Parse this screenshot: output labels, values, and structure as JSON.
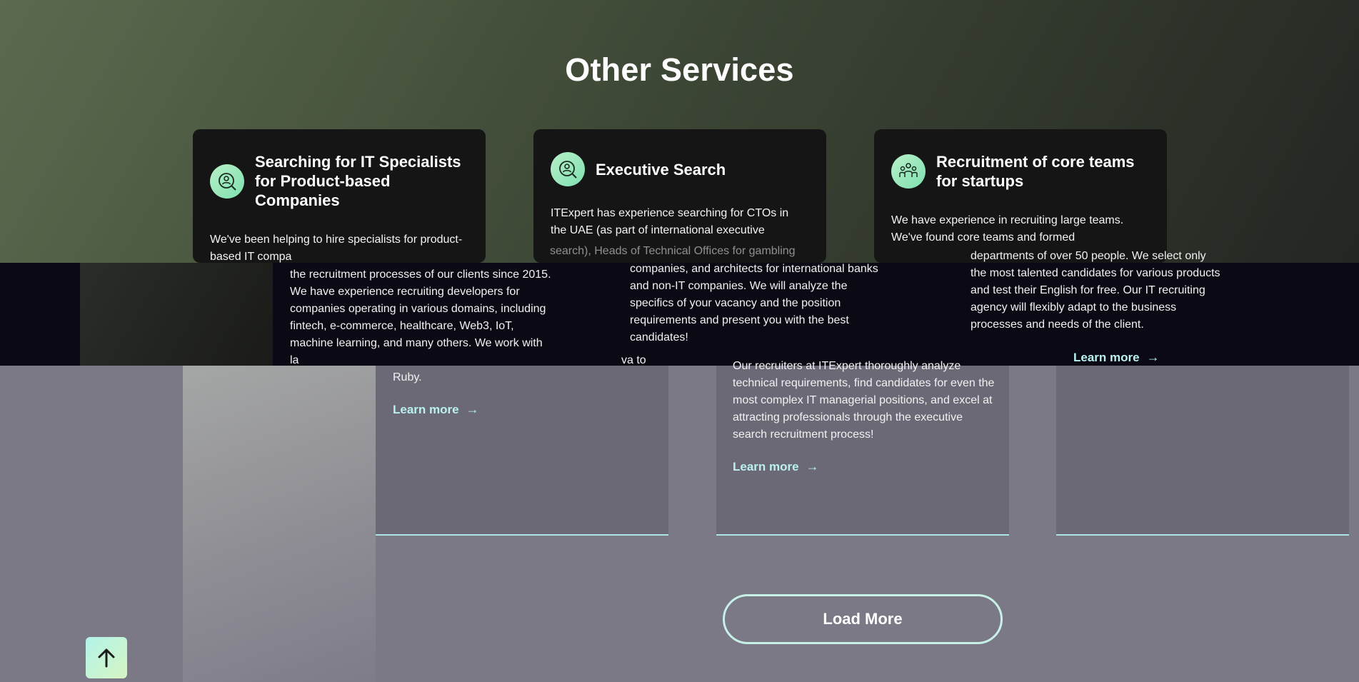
{
  "section": {
    "title": "Other Services"
  },
  "cards": [
    {
      "icon": "person-search-icon",
      "title": "Searching for IT Specialists for Product-based Companies",
      "intro": "We've been helping to hire specialists for product-based IT compa",
      "body": "the recruitment processes of our clients since 2015. We have experience recruiting developers for companies operating in various domains, including fintech, e-commerce, healthcare, Web3, IoT, machine learning, and many others. We work with la",
      "tail_suffix": "va to",
      "tail_end": "Ruby.",
      "learn_more": "Learn more"
    },
    {
      "icon": "person-search-icon",
      "title": "Executive Search",
      "intro": "ITExpert has experience searching for CTOs in the UAE (as part of international executive",
      "intro_tail": "search), Heads of Technical Offices for gambling",
      "body": "companies, and architects for international banks and non-IT companies. We will analyze the specifics of your vacancy and the position requirements and present you with the best candidates!",
      "extra": "Our recruiters at ITExpert thoroughly analyze technical requirements, find candidates for even the most complex IT managerial positions, and excel at attracting professionals through the executive search recruitment process!",
      "learn_more": "Learn more"
    },
    {
      "icon": "team-icon",
      "title": "Recruitment of core teams for startups",
      "intro": "We have experience in recruiting large teams. We've found core teams and formed",
      "body": "departments of over 50 people. We select only the most talented candidates for various products and test their English for free. Our IT recruiting agency will flexibly adapt to the business processes and needs of the client.",
      "learn_more": "Learn more"
    }
  ],
  "load_more": "Load More",
  "scroll_top": {
    "icon": "arrow-up-icon"
  }
}
